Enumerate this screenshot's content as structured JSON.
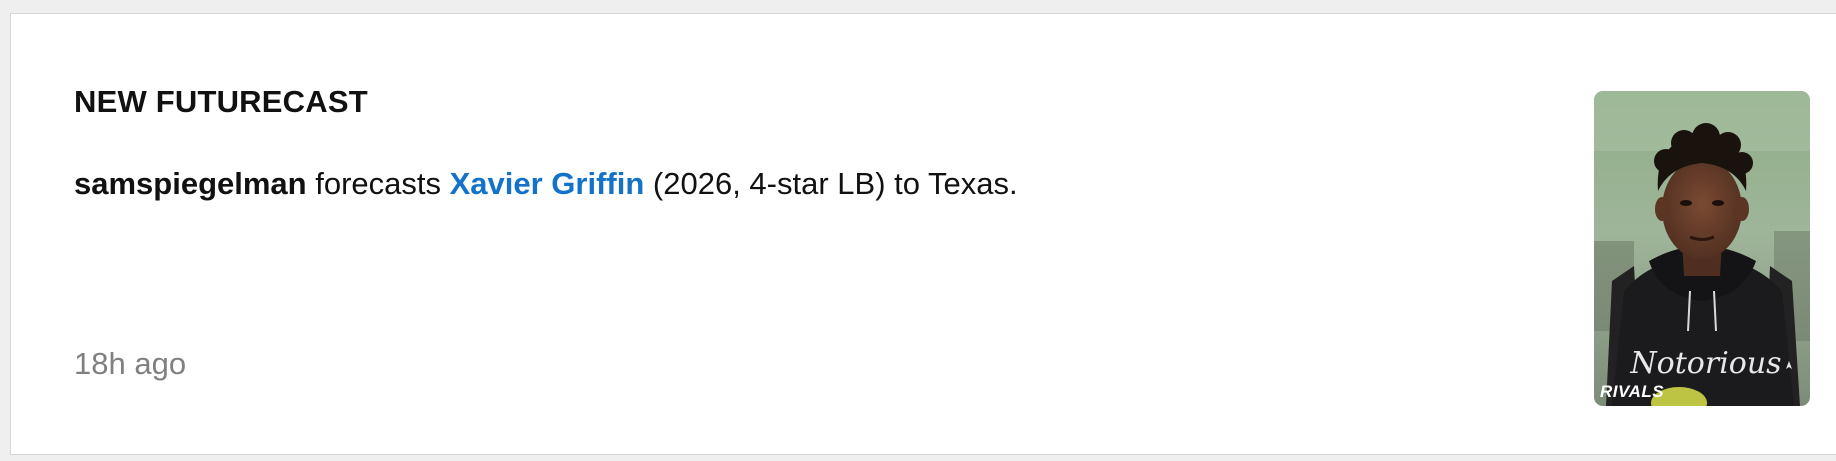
{
  "card": {
    "label": "NEW FUTURECAST",
    "username": "samspiegelman",
    "verb": " forecasts ",
    "player_name": "Xavier Griffin",
    "details": " (2026, 4-star LB) to Texas.",
    "timestamp": "18h ago"
  },
  "photo": {
    "alt": "Xavier Griffin",
    "watermark": "RIVALS",
    "shirt_text": "Notorious"
  },
  "colors": {
    "link": "#1372c9",
    "muted": "#808080",
    "text": "#111111"
  }
}
